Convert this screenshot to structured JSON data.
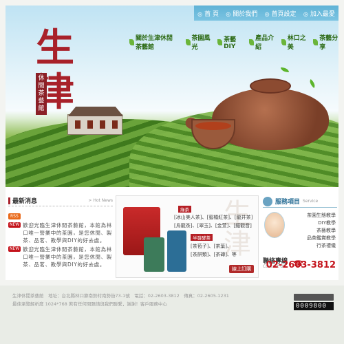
{
  "topbar": {
    "items": [
      "首  頁",
      "關於我們",
      "首頁設定",
      "加入最愛"
    ]
  },
  "nav": {
    "items": [
      "關於生津休閒茶藝館",
      "茶園風光",
      "茶藝DIY",
      "產品介紹",
      "林口之美",
      "茶藝分享"
    ]
  },
  "brand": {
    "main": "生津",
    "sub": "休閒茶藝館"
  },
  "news": {
    "title": "最新消息",
    "more": "> Hot News",
    "rss": "RSS",
    "new_badge": "NEW",
    "items": [
      "歡迎光臨生津休閒茶藝館，本館為林口唯一營業中的茶園，是您休閒、製茶、品茗、教學與DIY的好去處。",
      "歡迎光臨生津休閒茶藝館，本館為林口唯一營業中的茶園，是您休閒、製茶、品茗、教學與DIY的好去處。"
    ]
  },
  "product": {
    "watermark": "生津",
    "tag1": "綠茶",
    "line1": "[冰山美人茶]、[蜜橘紅茶]、[龍井茶]",
    "line2": "[烏龍茶]、[翠玉]、[金萱]、[鐵觀音]",
    "tag2": "半發酵茶",
    "line3": "[茶苞子]、[茶葉]、",
    "line4": "[茶餅類]、[茶磚]、等",
    "order": "線上訂購"
  },
  "service": {
    "title": "服務項目",
    "sub": "Service",
    "items": [
      "茶園生態教學",
      "DIY教學",
      "茶藝教學",
      "品茶鑑賞教學",
      "行茶禮儀"
    ]
  },
  "contact": {
    "title": "聯絡專線",
    "sub": "Contact US",
    "phone": "02-2603-3812"
  },
  "footer": {
    "line1": "生津休閒茶藝館　地址：台北縣林口鄉南勢村南勢街73-1號　電話：02-2603-3812　傳真：02-2605-1231",
    "line2": "最佳瀏覽解析度 1024*768 若有任何問題請與我們聯繫，謝謝！客戶服務中心",
    "counter": "0009800"
  }
}
